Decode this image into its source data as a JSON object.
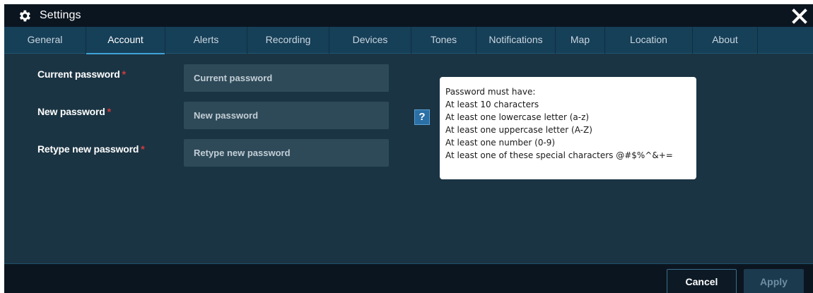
{
  "window": {
    "title": "Settings",
    "icons": {
      "title": "gear-icon",
      "close": "close-icon"
    }
  },
  "tabs": [
    {
      "label": "General",
      "active": false
    },
    {
      "label": "Account",
      "active": true
    },
    {
      "label": "Alerts",
      "active": false
    },
    {
      "label": "Recording",
      "active": false
    },
    {
      "label": "Devices",
      "active": false
    },
    {
      "label": "Tones",
      "active": false
    },
    {
      "label": "Notifications",
      "active": false
    },
    {
      "label": "Map",
      "active": false
    },
    {
      "label": "Location",
      "active": false
    },
    {
      "label": "About",
      "active": false
    }
  ],
  "form": {
    "required_marker": "*",
    "fields": [
      {
        "label": "Current password",
        "placeholder": "Current password",
        "value": ""
      },
      {
        "label": "New password",
        "placeholder": "New password",
        "value": ""
      },
      {
        "label": "Retype new password",
        "placeholder": "Retype new password",
        "value": ""
      }
    ],
    "help_label": "?"
  },
  "tooltip": {
    "lines": [
      "Password must have:",
      "At least 10 characters",
      "At least one lowercase letter (a-z)",
      "At least one uppercase letter (A-Z)",
      "At least one number (0-9)",
      "At least one of these special characters @#$%^&+="
    ]
  },
  "footer": {
    "cancel_label": "Cancel",
    "apply_label": "Apply"
  },
  "colors": {
    "titlebar_bg": "#0b1520",
    "tabbar_bg": "#163f58",
    "content_bg": "#1b3443",
    "input_bg": "#2e4a59",
    "required": "#d33b3b",
    "active_tab_underline": "#3fa3d6",
    "help_button": "#2a6fa5"
  }
}
